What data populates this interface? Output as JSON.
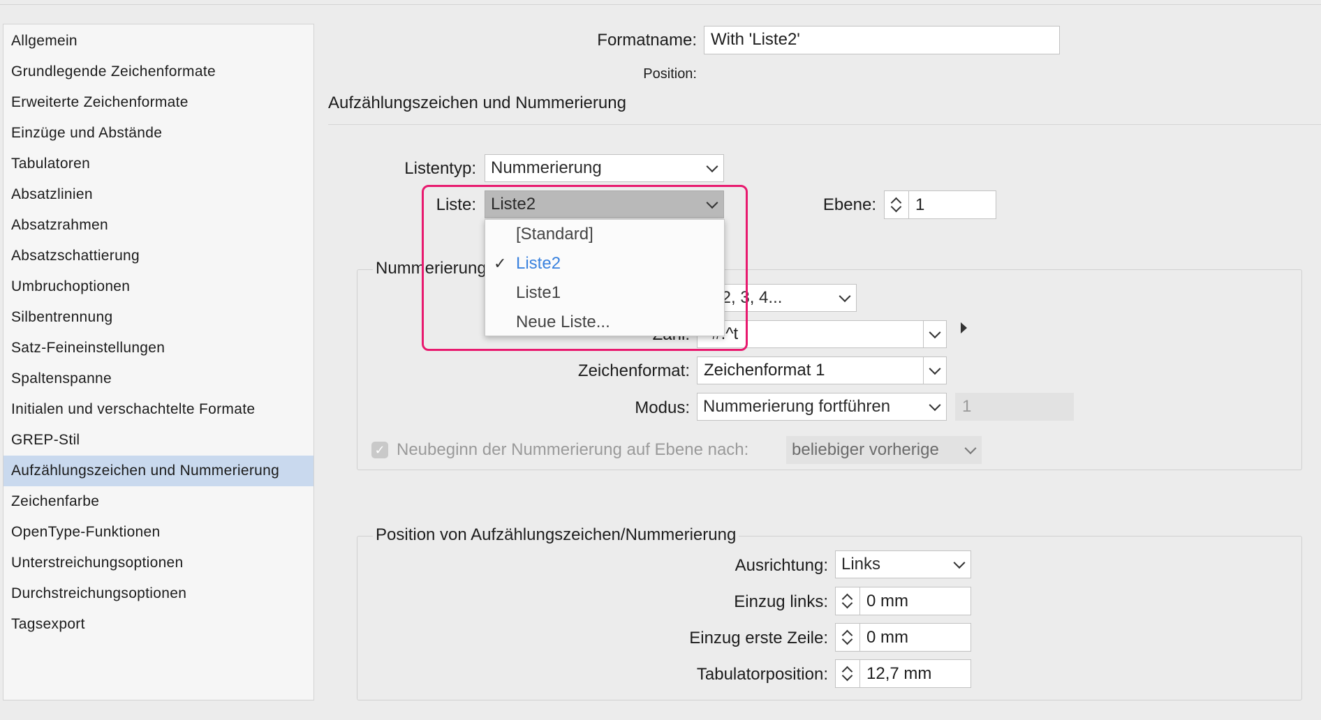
{
  "sidebar": {
    "items": [
      {
        "label": "Allgemein"
      },
      {
        "label": "Grundlegende Zeichenformate"
      },
      {
        "label": "Erweiterte Zeichenformate"
      },
      {
        "label": "Einzüge und Abstände"
      },
      {
        "label": "Tabulatoren"
      },
      {
        "label": "Absatzlinien"
      },
      {
        "label": "Absatzrahmen"
      },
      {
        "label": "Absatzschattierung"
      },
      {
        "label": "Umbruchoptionen"
      },
      {
        "label": "Silbentrennung"
      },
      {
        "label": "Satz-Feineinstellungen"
      },
      {
        "label": "Spaltenspanne"
      },
      {
        "label": "Initialen und verschachtelte Formate"
      },
      {
        "label": "GREP-Stil"
      },
      {
        "label": "Aufzählungszeichen und Nummerierung",
        "selected": true
      },
      {
        "label": "Zeichenfarbe"
      },
      {
        "label": "OpenType-Funktionen"
      },
      {
        "label": "Unterstreichungsoptionen"
      },
      {
        "label": "Durchstreichungsoptionen"
      },
      {
        "label": "Tagsexport"
      }
    ]
  },
  "header": {
    "formatname_label": "Formatname:",
    "formatname_value": "With 'Liste2'",
    "position_label": "Position:",
    "section_title": "Aufzählungszeichen und Nummerierung"
  },
  "list": {
    "listentyp_label": "Listentyp:",
    "listentyp_value": "Nummerierung",
    "liste_label": "Liste:",
    "liste_value": "Liste2",
    "ebene_label": "Ebene:",
    "ebene_value": "1"
  },
  "dropdown": {
    "options": [
      {
        "label": "[Standard]"
      },
      {
        "label": "Liste2",
        "selected": true
      },
      {
        "label": "Liste1"
      },
      {
        "label": "Neue Liste..."
      }
    ],
    "check_glyph": "✓"
  },
  "numbering": {
    "group_title": "Nummerierungsstil",
    "format_value": "1, 2, 3, 4...",
    "zahl_label": "Zahl:",
    "zahl_value": "^#.^t",
    "zeichenformat_label": "Zeichenformat:",
    "zeichenformat_value": "Zeichenformat 1",
    "modus_label": "Modus:",
    "modus_value": "Nummerierung fortführen",
    "modus_start_value": "1",
    "restart_label": "Neubeginn der Nummerierung auf Ebene nach:",
    "restart_checked": true,
    "restart_value": "beliebiger vorherige"
  },
  "position": {
    "group_title": "Position von Aufzählungszeichen/Nummerierung",
    "ausrichtung_label": "Ausrichtung:",
    "ausrichtung_value": "Links",
    "einzug_links_label": "Einzug links:",
    "einzug_links_value": "0 mm",
    "einzug_erste_label": "Einzug erste Zeile:",
    "einzug_erste_value": "0 mm",
    "tab_label": "Tabulatorposition:",
    "tab_value": "12,7 mm"
  },
  "colors": {
    "selection": "#c9d9ee",
    "highlight": "#e8196e",
    "dropdown_selected_text": "#3a82de"
  }
}
